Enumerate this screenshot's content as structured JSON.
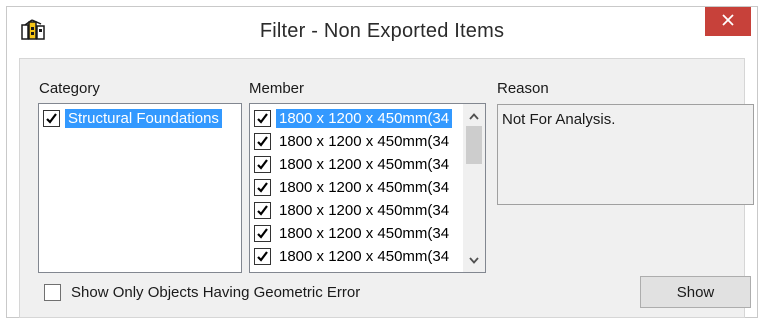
{
  "window": {
    "title": "Filter - Non Exported Items",
    "app_icon": "revit-building-icon",
    "close_icon": "close-icon"
  },
  "category": {
    "label": "Category",
    "items": [
      {
        "label": "Structural Foundations",
        "checked": true,
        "selected": true
      }
    ]
  },
  "member": {
    "label": "Member",
    "items": [
      {
        "label": "1800 x 1200 x 450mm(34",
        "checked": true,
        "selected": true
      },
      {
        "label": "1800 x 1200 x 450mm(34",
        "checked": true,
        "selected": false
      },
      {
        "label": "1800 x 1200 x 450mm(34",
        "checked": true,
        "selected": false
      },
      {
        "label": "1800 x 1200 x 450mm(34",
        "checked": true,
        "selected": false
      },
      {
        "label": "1800 x 1200 x 450mm(34",
        "checked": true,
        "selected": false
      },
      {
        "label": "1800 x 1200 x 450mm(34",
        "checked": true,
        "selected": false
      },
      {
        "label": "1800 x 1200 x 450mm(34",
        "checked": true,
        "selected": false
      }
    ]
  },
  "reason": {
    "label": "Reason",
    "text": "Not For Analysis."
  },
  "geometric_error": {
    "label": "Show Only Objects Having Geometric Error",
    "checked": false
  },
  "show_button": {
    "label": "Show"
  },
  "colors": {
    "close_button": "#c7413a",
    "selection": "#3399ff",
    "panel_background": "#f0f0f0"
  }
}
